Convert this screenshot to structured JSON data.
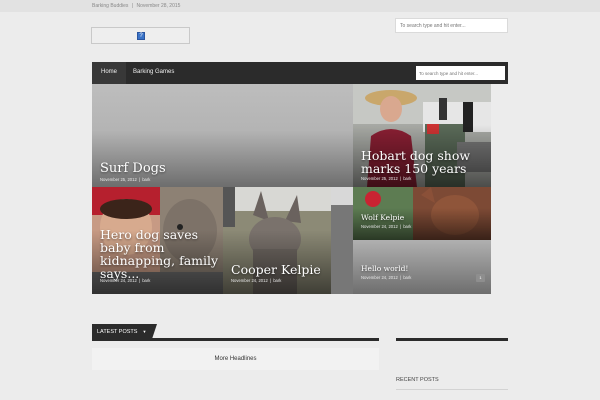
{
  "topbar": {
    "site_name": "Barking Buddies",
    "separator": "|",
    "date": "November 28, 2015"
  },
  "header": {
    "broken_logo_glyph": "?"
  },
  "search": {
    "placeholder": "To search type and hit enter..."
  },
  "nav": {
    "items": [
      {
        "label": "Home"
      },
      {
        "label": "Barking Games"
      }
    ]
  },
  "featured": [
    {
      "title": "Surf Dogs",
      "date": "November 25, 2012",
      "author": "bark"
    },
    {
      "title": "Hobart dog show marks 150 years",
      "date": "November 25, 2012",
      "author": "bark"
    },
    {
      "title": "Hero dog saves baby from kidnapping, family says...",
      "date": "November 24, 2012",
      "author": "bark"
    },
    {
      "title": "Cooper Kelpie",
      "date": "November 24, 2012",
      "author": "bark"
    },
    {
      "title": "Wolf Kelpie",
      "date": "November 24, 2012",
      "author": "bark"
    },
    {
      "title": "Hello world!",
      "date": "November 24, 2012",
      "author": "bark",
      "comments": "1"
    }
  ],
  "meta_separator": "|",
  "latest": {
    "tab_label": "LATEST POSTS",
    "caret": "▼",
    "headlines_label": "More Headlines"
  },
  "sidebar": {
    "recent_title": "RECENT POSTS"
  },
  "colors": {
    "nav_bg": "#2b2b2b",
    "page_bg": "#ececec"
  }
}
